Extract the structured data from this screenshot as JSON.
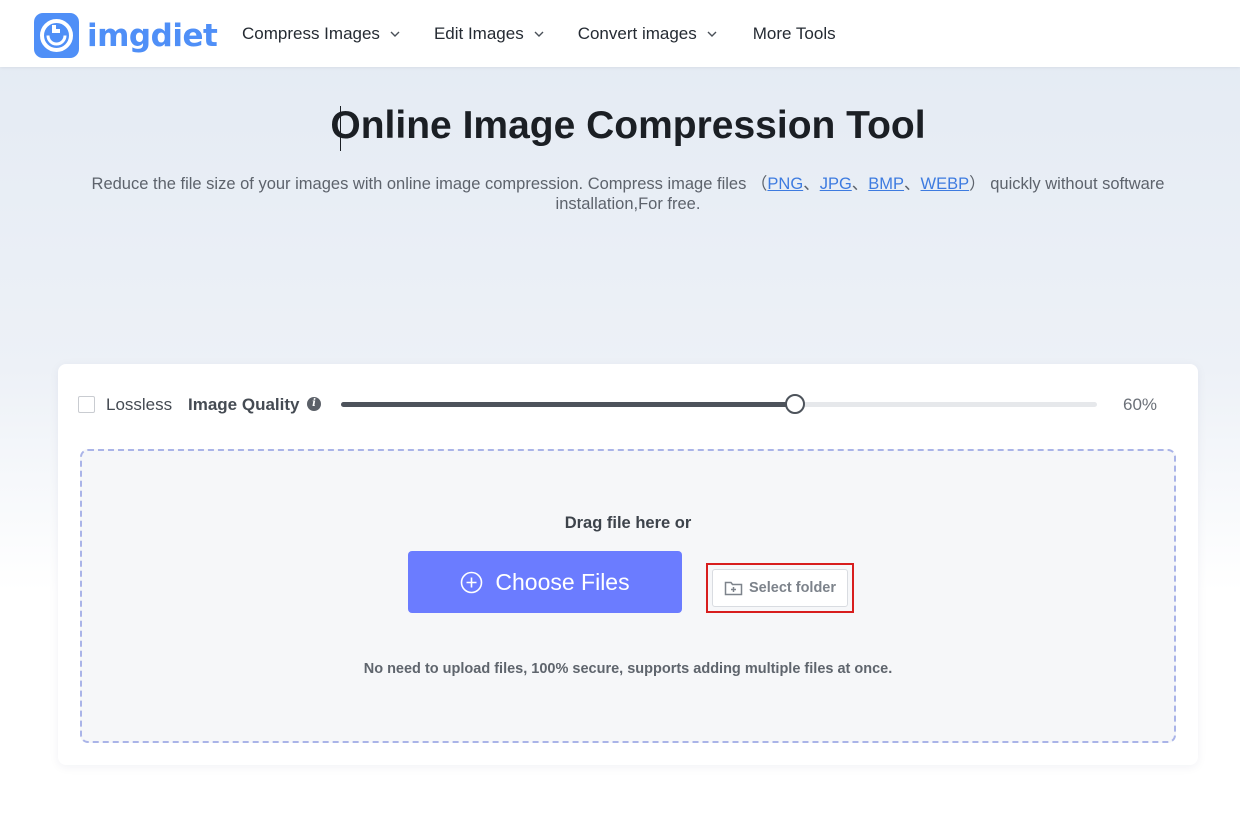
{
  "brand": {
    "part1": "img",
    "part2": "diet",
    "color": "#4f8ff7"
  },
  "nav": {
    "items": [
      {
        "label": "Compress Images",
        "dropdown": true
      },
      {
        "label": "Edit Images",
        "dropdown": true
      },
      {
        "label": "Convert images",
        "dropdown": true
      },
      {
        "label": "More Tools",
        "dropdown": false
      }
    ]
  },
  "hero": {
    "title": "Online Image Compression Tool",
    "subtitle_before": "Reduce the file size of your images with online image compression. Compress image files （",
    "formats": [
      "PNG",
      "JPG",
      "BMP",
      "WEBP"
    ],
    "separator": "、",
    "subtitle_after": "） quickly without software installation,For free."
  },
  "options": {
    "lossless_label": "Lossless",
    "lossless_checked": false,
    "quality_label": "Image Quality",
    "quality_value_label": "60%",
    "quality_fraction": 0.6
  },
  "dropzone": {
    "drag_text": "Drag file here or",
    "choose_label": "Choose Files",
    "folder_label": "Select folder",
    "secure_text": "No need to upload files, 100% secure, supports adding multiple files at once."
  },
  "colors": {
    "accent": "#6b7cff",
    "highlight": "#d81e1e",
    "link": "#3d7be0"
  }
}
